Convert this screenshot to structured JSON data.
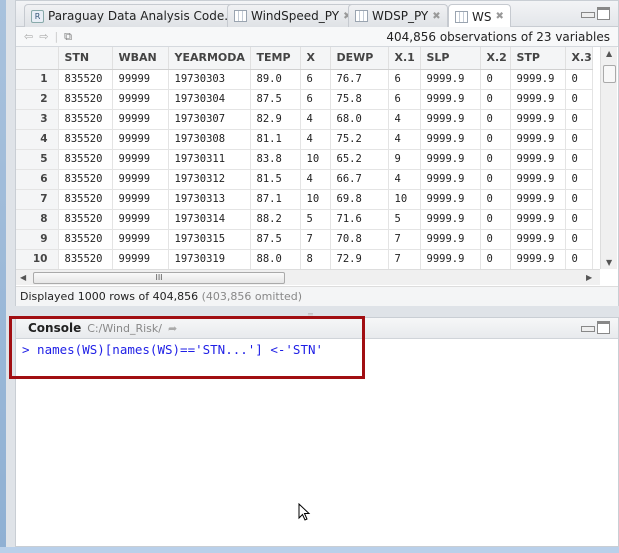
{
  "tabs": [
    {
      "label": "Paraguay Data Analysis Code.R",
      "icon": "r-script-icon"
    },
    {
      "label": "WindSpeed_PY",
      "icon": "table-icon"
    },
    {
      "label": "WDSP_PY",
      "icon": "table-icon"
    },
    {
      "label": "WS",
      "icon": "table-icon",
      "active": true
    }
  ],
  "toolbar": {
    "observations": "404,856 observations of 23 variables"
  },
  "table": {
    "columns": [
      "",
      "STN",
      "WBAN",
      "YEARMODA",
      "TEMP",
      "X",
      "DEWP",
      "X.1",
      "SLP",
      "X.2",
      "STP",
      "X.3"
    ],
    "rows": [
      [
        "1",
        "835520",
        "99999",
        "19730303",
        "89.0",
        "6",
        "76.7",
        "6",
        "9999.9",
        "0",
        "9999.9",
        "0"
      ],
      [
        "2",
        "835520",
        "99999",
        "19730304",
        "87.5",
        "6",
        "75.8",
        "6",
        "9999.9",
        "0",
        "9999.9",
        "0"
      ],
      [
        "3",
        "835520",
        "99999",
        "19730307",
        "82.9",
        "4",
        "68.0",
        "4",
        "9999.9",
        "0",
        "9999.9",
        "0"
      ],
      [
        "4",
        "835520",
        "99999",
        "19730308",
        "81.1",
        "4",
        "75.2",
        "4",
        "9999.9",
        "0",
        "9999.9",
        "0"
      ],
      [
        "5",
        "835520",
        "99999",
        "19730311",
        "83.8",
        "10",
        "65.2",
        "9",
        "9999.9",
        "0",
        "9999.9",
        "0"
      ],
      [
        "6",
        "835520",
        "99999",
        "19730312",
        "81.5",
        "4",
        "66.7",
        "4",
        "9999.9",
        "0",
        "9999.9",
        "0"
      ],
      [
        "7",
        "835520",
        "99999",
        "19730313",
        "87.1",
        "10",
        "69.8",
        "10",
        "9999.9",
        "0",
        "9999.9",
        "0"
      ],
      [
        "8",
        "835520",
        "99999",
        "19730314",
        "88.2",
        "5",
        "71.6",
        "5",
        "9999.9",
        "0",
        "9999.9",
        "0"
      ],
      [
        "9",
        "835520",
        "99999",
        "19730315",
        "87.5",
        "7",
        "70.8",
        "7",
        "9999.9",
        "0",
        "9999.9",
        "0"
      ],
      [
        "10",
        "835520",
        "99999",
        "19730319",
        "88.0",
        "8",
        "72.9",
        "7",
        "9999.9",
        "0",
        "9999.9",
        "0"
      ]
    ]
  },
  "status": {
    "displayed": "Displayed 1000 rows of 404,856",
    "omitted": "(403,856 omitted)"
  },
  "console": {
    "title": "Console",
    "path": "C:/Wind_Risk/",
    "command": "> names(WS)[names(WS)=='STN...'] <-'STN'"
  },
  "colors": {
    "highlight": "#a10e12",
    "command": "#1f1fe6"
  }
}
